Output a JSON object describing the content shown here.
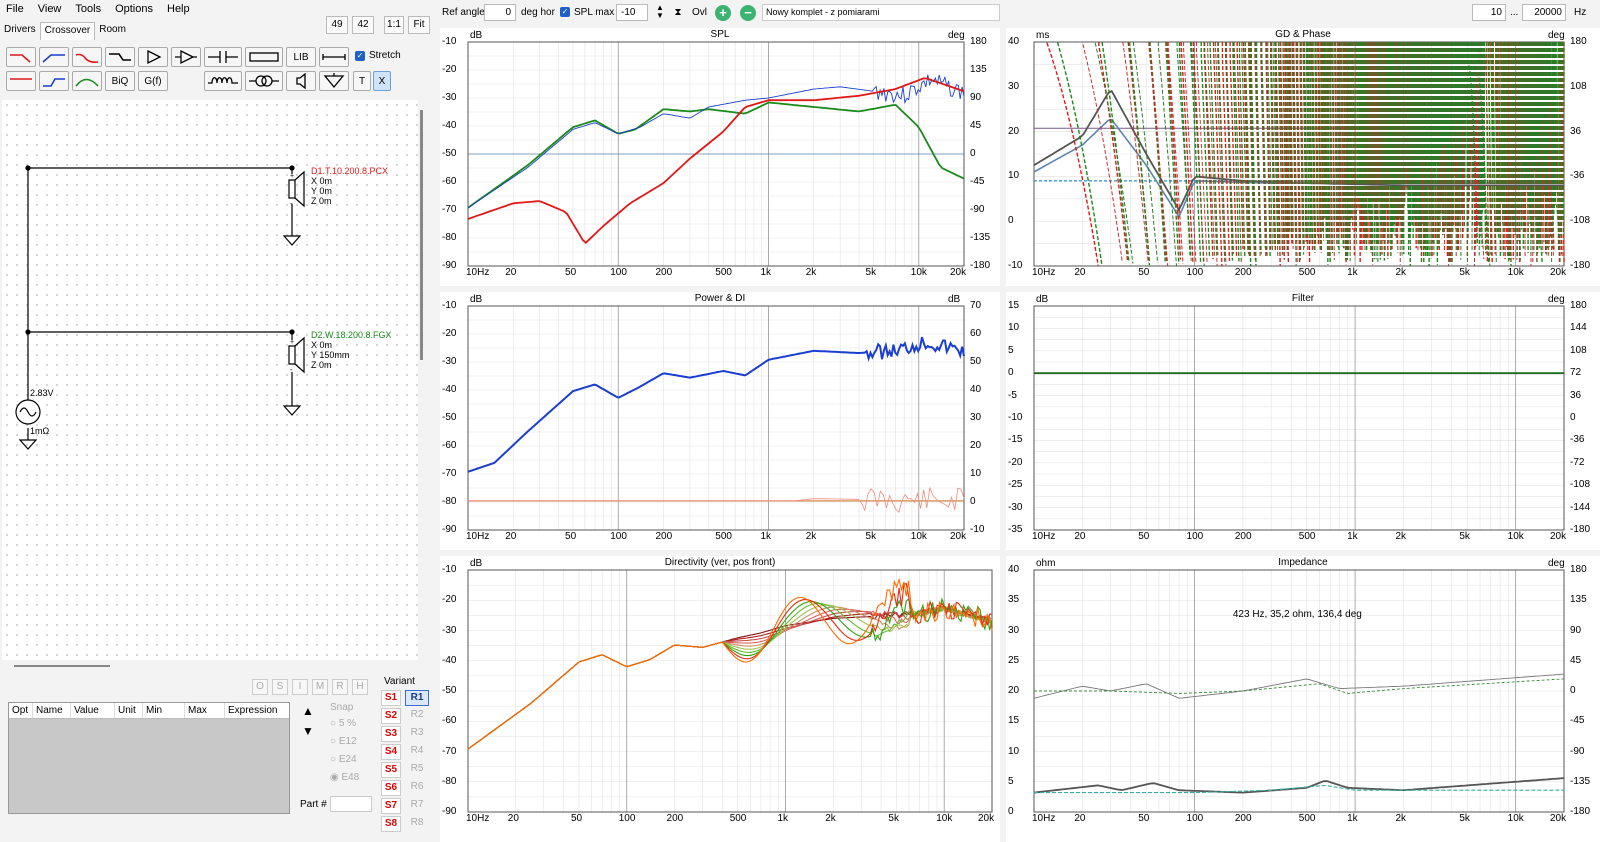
{
  "menu": [
    "File",
    "View",
    "Tools",
    "Options",
    "Help"
  ],
  "tabs": [
    "Drivers",
    "Crossover",
    "Room"
  ],
  "zoom": {
    "a": "49",
    "b": "42",
    "one": "1:1",
    "fit": "Fit"
  },
  "toolbar": {
    "lib": "LIB",
    "biq": "BiQ",
    "gf": "G(f)",
    "stretch": "Stretch",
    "t": "T",
    "x": "X"
  },
  "schematic": {
    "d1": {
      "name": "D1.T.10.200.8.PCX",
      "x": "X 0m",
      "y": "Y 0m",
      "z": "Z 0m"
    },
    "d2": {
      "name": "D2.W.18.200.8.FGX",
      "x": "X 0m",
      "y": "Y 150mm",
      "z": "Z 0m"
    },
    "source": {
      "voltage": "2.83V",
      "impedance": "1mΩ"
    }
  },
  "param_letters": [
    "O",
    "S",
    "I",
    "M",
    "R",
    "H"
  ],
  "param_table": {
    "columns": [
      "Opt",
      "Name",
      "Value",
      "Unit",
      "Min",
      "Max",
      "Expression"
    ]
  },
  "snap": {
    "label": "Snap",
    "options": [
      "5 %",
      "E12",
      "E24",
      "E48"
    ]
  },
  "part_label": "Part #",
  "variant": {
    "label": "Variant",
    "s": [
      "S1",
      "S2",
      "S3",
      "S4",
      "S5",
      "S6",
      "S7",
      "S8"
    ],
    "r": [
      "R1",
      "R2",
      "R3",
      "R4",
      "R5",
      "R6",
      "R7",
      "R8"
    ]
  },
  "topbar": {
    "ref_angle_label": "Ref angle",
    "ref_angle": "0",
    "deg_hor": "deg hor",
    "spl_max_label": "SPL max",
    "spl_max": "-10",
    "ovl": "Ovl",
    "project": "Nowy komplet - z pomiarami",
    "f_min": "10",
    "dots": "...",
    "f_max": "20000",
    "hz": "Hz"
  },
  "xticks": [
    "10Hz",
    "20",
    "50",
    "100",
    "200",
    "500",
    "1k",
    "2k",
    "5k",
    "10k",
    "20k"
  ],
  "plots": {
    "spl": {
      "title": "SPL",
      "left_unit": "dB",
      "right_unit": "deg",
      "left": [
        "-10",
        "-20",
        "-30",
        "-40",
        "-50",
        "-60",
        "-70",
        "-80",
        "-90"
      ],
      "right": [
        "180",
        "135",
        "90",
        "45",
        "0",
        "-45",
        "-90",
        "-135",
        "-180"
      ]
    },
    "gd": {
      "title": "GD & Phase",
      "left_unit": "ms",
      "right_unit": "deg",
      "left": [
        "40",
        "30",
        "20",
        "10",
        "0",
        "-10"
      ],
      "right": [
        "180",
        "108",
        "36",
        "-36",
        "-108",
        "-180"
      ]
    },
    "power": {
      "title": "Power & DI",
      "left_unit": "dB",
      "right_unit": "dB",
      "left": [
        "-10",
        "-20",
        "-30",
        "-40",
        "-50",
        "-60",
        "-70",
        "-80",
        "-90"
      ],
      "right": [
        "70",
        "60",
        "50",
        "40",
        "30",
        "20",
        "10",
        "0",
        "-10"
      ]
    },
    "filter": {
      "title": "Filter",
      "left_unit": "dB",
      "right_unit": "deg",
      "left": [
        "15",
        "10",
        "5",
        "0",
        "-5",
        "-10",
        "-15",
        "-20",
        "-25",
        "-30",
        "-35"
      ],
      "right": [
        "180",
        "144",
        "108",
        "72",
        "36",
        "0",
        "-36",
        "-72",
        "-108",
        "-144",
        "-180"
      ]
    },
    "dir": {
      "title": "Directivity (ver, pos front)",
      "left_unit": "dB",
      "left": [
        "-10",
        "-20",
        "-30",
        "-40",
        "-50",
        "-60",
        "-70",
        "-80",
        "-90"
      ]
    },
    "imp": {
      "title": "Impedance",
      "left_unit": "ohm",
      "right_unit": "deg",
      "left": [
        "40",
        "35",
        "30",
        "25",
        "20",
        "15",
        "10",
        "5",
        "0"
      ],
      "right": [
        "180",
        "135",
        "90",
        "45",
        "0",
        "-45",
        "-90",
        "-135",
        "-180"
      ],
      "readout": "423 Hz, 35,2 ohm, 136,4 deg"
    }
  },
  "colors": {
    "red": "#e01818",
    "blue": "#1a3fd0",
    "green": "#1a8a1a",
    "gray": "#666666",
    "steel": "#5c86b0"
  }
}
